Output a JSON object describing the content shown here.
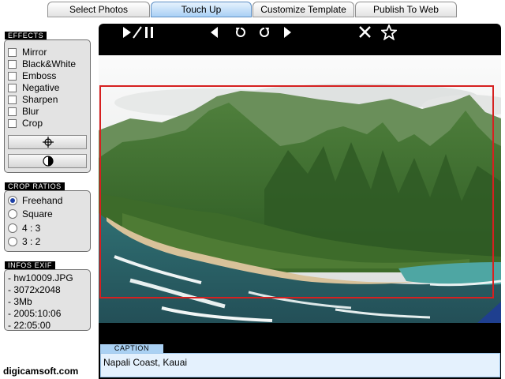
{
  "tabs": [
    {
      "label": "Select Photos"
    },
    {
      "label": "Touch Up"
    },
    {
      "label": "Customize Template"
    },
    {
      "label": "Publish To Web"
    }
  ],
  "active_tab": "Touch Up",
  "effects": {
    "title": "EFFECTS",
    "items": [
      {
        "label": "Mirror"
      },
      {
        "label": "Black&White"
      },
      {
        "label": "Emboss"
      },
      {
        "label": "Negative"
      },
      {
        "label": "Sharpen"
      },
      {
        "label": "Blur"
      },
      {
        "label": "Crop"
      }
    ],
    "buttons": [
      {
        "icon": "crosshair-icon"
      },
      {
        "icon": "contrast-icon"
      }
    ]
  },
  "crop_ratios": {
    "title": "CROP RATIOS",
    "selected": "Freehand",
    "items": [
      {
        "label": "Freehand"
      },
      {
        "label": "Square"
      },
      {
        "label": "4 : 3"
      },
      {
        "label": "3 : 2"
      }
    ]
  },
  "exif": {
    "title": "INFOS EXIF",
    "lines": [
      "- hw10009.JPG",
      "- 3072x2048",
      "- 3Mb",
      "- 2005:10:06",
      "- 22:05:00"
    ]
  },
  "brand": "digicamsoft.com",
  "toolbar": {
    "icons": [
      "play-pause-icon",
      "previous-icon",
      "rotate-left-icon",
      "rotate-right-icon",
      "next-icon",
      "close-icon",
      "star-icon"
    ]
  },
  "caption": {
    "label": "CAPTION",
    "value": "Napali Coast, Kauai"
  },
  "colors": {
    "active_tab": "#a9d0f5",
    "crop_box": "#d62020",
    "caption_bg": "#e4f1fd"
  }
}
